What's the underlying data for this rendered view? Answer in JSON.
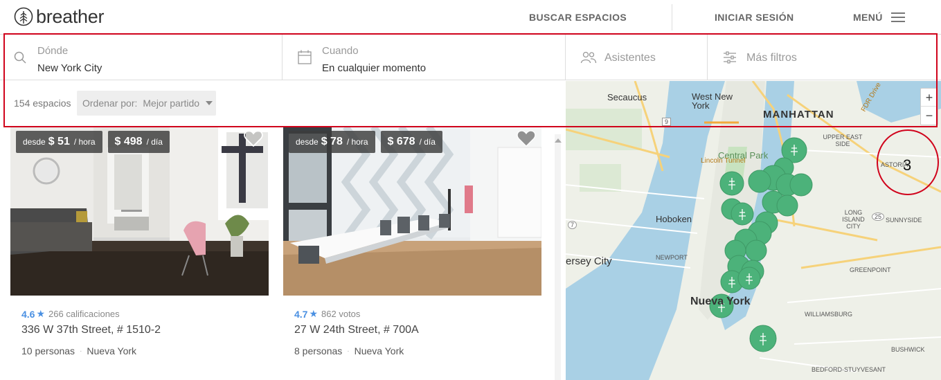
{
  "header": {
    "logo_text": "breather",
    "nav_search": "BUSCAR ESPACIOS",
    "nav_login": "INICIAR SESIÓN",
    "nav_menu": "MENÚ"
  },
  "search": {
    "where_label": "Dónde",
    "where_value": "New York City",
    "when_label": "Cuando",
    "when_value": "En cualquier momento",
    "guests_label": "Asistentes",
    "filters_label": "Más filtros"
  },
  "results": {
    "count": "154 espacios",
    "sort_label": "Ordenar por:",
    "sort_value": "Mejor partido"
  },
  "cards": [
    {
      "from": "desde",
      "hour_price": "$ 51",
      "hour_unit": "/ hora",
      "day_price": "$ 498",
      "day_unit": "/ día",
      "rating": "4.6",
      "reviews": "266 calificaciones",
      "address": "336 W 37th Street, # 1510-2",
      "capacity": "10 personas",
      "city": "Nueva York"
    },
    {
      "from": "desde",
      "hour_price": "$ 78",
      "hour_unit": "/ hora",
      "day_price": "$ 678",
      "day_unit": "/ día",
      "rating": "4.7",
      "reviews": "862 votos",
      "address": "27 W 24th Street, # 700A",
      "capacity": "8 personas",
      "city": "Nueva York"
    }
  ],
  "map": {
    "labels": {
      "secaucus": "Secaucus",
      "west_ny": "West New York",
      "manhattan": "MANHATTAN",
      "central_park": "Central Park",
      "lincoln": "Lincoln Tunnel",
      "hoboken": "Hoboken",
      "jersey_city": "ersey City",
      "newport": "NEWPORT",
      "new_york": "Nueva York",
      "astoria": "ASTORIA",
      "upper_east": "UPPER EAST SIDE",
      "long_island": "LONG ISLAND CITY",
      "sunnyside": "SUNNYSIDE",
      "greenpoint": "GREENPOINT",
      "williamsburg": "WILLIAMSBURG",
      "bushwick": "BUSHWICK",
      "bed_stuy": "BEDFORD-STUYVESANT",
      "fdr": "FDR Drive",
      "route_9": "9",
      "route_7": "7",
      "route_25": "25"
    },
    "zoom_in": "+",
    "zoom_out": "−",
    "annotation": "3"
  },
  "colors": {
    "accent_blue": "#4a90e2",
    "pin_green": "#4cb27a",
    "annotation_red": "#d0021b"
  }
}
